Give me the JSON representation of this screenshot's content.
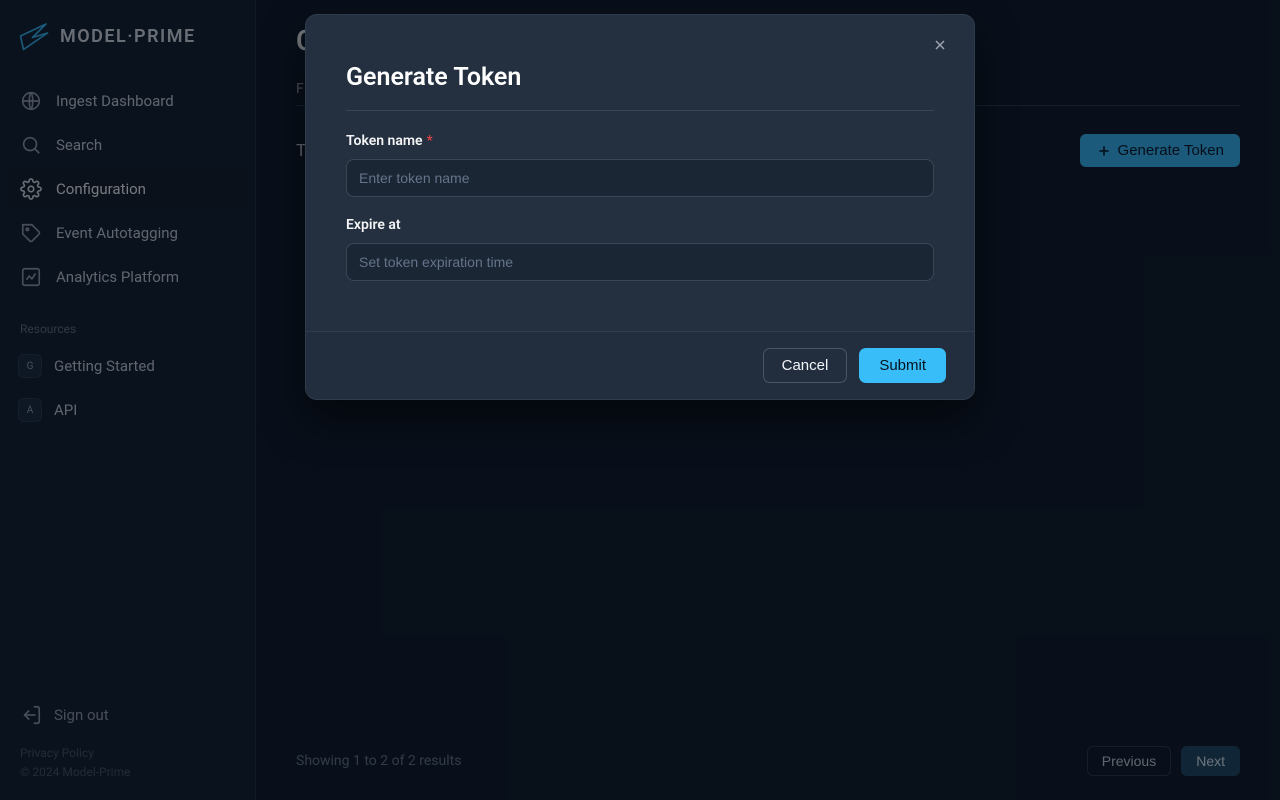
{
  "brand": {
    "name": "MODEL·PRIME"
  },
  "sidebar": {
    "items": [
      {
        "label": "Ingest Dashboard"
      },
      {
        "label": "Search"
      },
      {
        "label": "Configuration"
      },
      {
        "label": "Event Autotagging"
      },
      {
        "label": "Analytics Platform"
      }
    ],
    "resources_label": "Resources",
    "resources": [
      {
        "badge": "G",
        "label": "Getting Started"
      },
      {
        "badge": "A",
        "label": "API"
      }
    ],
    "signout": "Sign out",
    "footer": {
      "privacy": "Privacy Policy",
      "copyright": "© 2024 Model-Prime"
    }
  },
  "page": {
    "title": "C",
    "tab": "F",
    "section_left": "T",
    "generate_button": "Generate Token",
    "results": "Showing 1 to 2 of 2 results",
    "prev": "Previous",
    "next": "Next"
  },
  "modal": {
    "title": "Generate Token",
    "fields": {
      "token_name": {
        "label": "Token name",
        "placeholder": "Enter token name",
        "required": true
      },
      "expire_at": {
        "label": "Expire at",
        "placeholder": "Set token expiration time"
      }
    },
    "cancel": "Cancel",
    "submit": "Submit"
  }
}
